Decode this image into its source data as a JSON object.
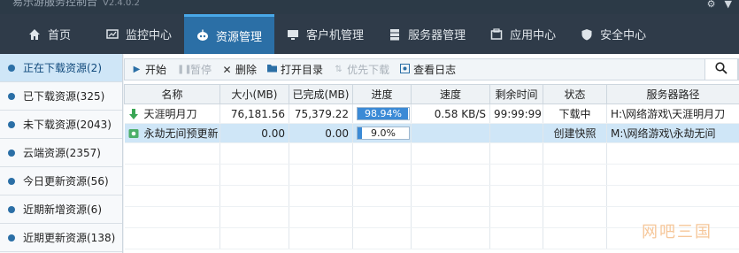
{
  "window": {
    "title": "易乐游服务控制台",
    "version": "V2.4.0.2"
  },
  "nav": [
    {
      "label": "首页",
      "icon": "home-icon",
      "active": false
    },
    {
      "label": "监控中心",
      "icon": "monitor-chart-icon",
      "active": false
    },
    {
      "label": "资源管理",
      "icon": "resource-robot-icon",
      "active": true
    },
    {
      "label": "客户机管理",
      "icon": "client-monitor-icon",
      "active": false
    },
    {
      "label": "服务器管理",
      "icon": "server-icon",
      "active": false
    },
    {
      "label": "应用中心",
      "icon": "app-box-icon",
      "active": false
    },
    {
      "label": "安全中心",
      "icon": "shield-icon",
      "active": false
    }
  ],
  "sidebar": {
    "items": [
      {
        "label": "正在下载资源(2)",
        "active": true
      },
      {
        "label": "已下载资源(325)",
        "active": false
      },
      {
        "label": "未下载资源(2043)",
        "active": false
      },
      {
        "label": "云端资源(2357)",
        "active": false
      },
      {
        "label": "今日更新资源(56)",
        "active": false
      },
      {
        "label": "近期新增资源(6)",
        "active": false
      },
      {
        "label": "近期更新资源(138)",
        "active": false
      }
    ]
  },
  "toolbar": {
    "start": "开始",
    "pause": "暂停",
    "delete": "删除",
    "open_dir": "打开目录",
    "priority": "优先下载",
    "view_log": "查看日志"
  },
  "table": {
    "columns": [
      "名称",
      "大小(MB)",
      "已完成(MB)",
      "进度",
      "速度",
      "剩余时间",
      "状态",
      "服务器路径"
    ],
    "rows": [
      {
        "name": "天涯明月刀",
        "size": "76,181.56",
        "done": "75,379.22",
        "progress_label": "98.94%",
        "progress": 0.9894,
        "speed": "0.58 KB/S",
        "remaining": "99:99:99",
        "status": "下载中",
        "path": "H:\\网络游戏\\天涯明月刀",
        "icon": "download-arrow-icon",
        "selected": false
      },
      {
        "name": "永劫无间预更新",
        "size": "0.00",
        "done": "0.00",
        "progress_label": "9.0%",
        "progress": 0.09,
        "speed": "",
        "remaining": "",
        "status": "创建快照",
        "path": "M:\\网络游戏\\永劫无间",
        "icon": "snapshot-icon",
        "selected": true
      }
    ]
  },
  "watermark": "网吧三国",
  "colors": {
    "nav_bg": "#2f3b49",
    "accent": "#2b6fa6",
    "selection": "#cfe6f7",
    "progress": "#3b8ad6"
  }
}
